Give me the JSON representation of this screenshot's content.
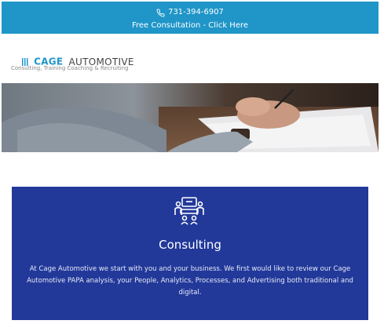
{
  "topbar": {
    "phone": "731-394-6907",
    "cta": "Free Consultation - Click Here",
    "icon": "phone-icon"
  },
  "header": {
    "logo_brand": "CAGE",
    "logo_word": "AUTOMOTIVE",
    "tagline": "Consulting, Training Coaching & Recruiting",
    "menu_icon": "hamburger-menu-icon"
  },
  "hero": {
    "image": "hands-signing-document-photo"
  },
  "card": {
    "icon": "consulting-meeting-icon",
    "heading": "Consulting",
    "body": "At Cage Automotive we start with you and your business. We first would like to review our Cage Automotive PAPA analysis, your People, Analytics, Processes, and Advertising both traditional and digital."
  },
  "colors": {
    "topbar": "#1f95c8",
    "card": "#22399a",
    "brand": "#1f95c8"
  }
}
